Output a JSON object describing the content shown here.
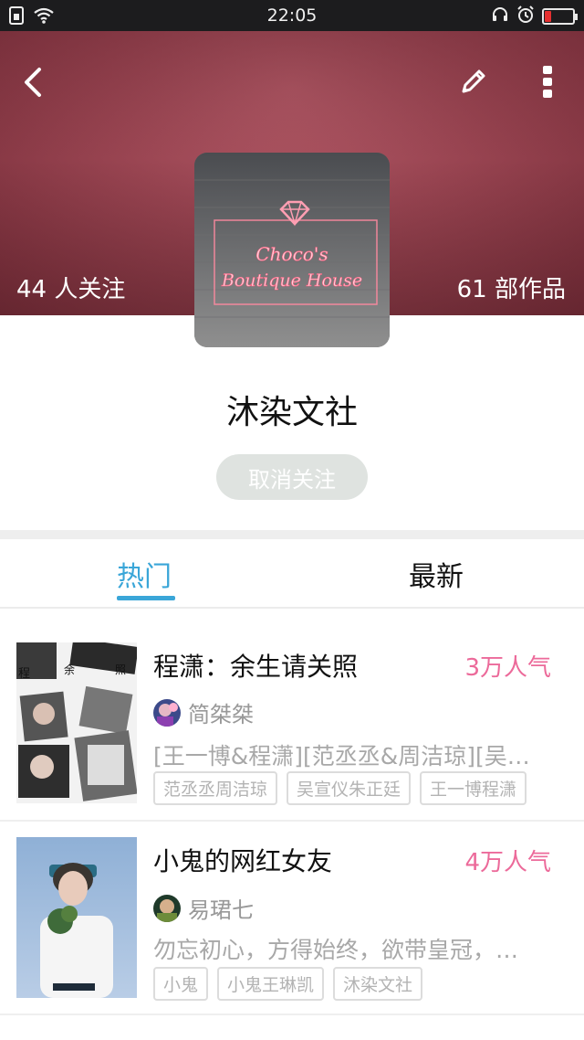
{
  "status_bar": {
    "time": "22:05"
  },
  "header": {
    "followers": "44 人关注",
    "works": "61 部作品",
    "cover_sign_line1": "Choco's",
    "cover_sign_line2": "Boutique House"
  },
  "group": {
    "name": "沐染文社",
    "unfollow_label": "取消关注"
  },
  "tabs": [
    {
      "label": "热门",
      "active": true
    },
    {
      "label": "最新",
      "active": false
    }
  ],
  "works": [
    {
      "title": "程潇：余生请关照",
      "popularity": "3万人气",
      "author": "简桀桀",
      "description": "[王一博&程潇][范丞丞&周洁琼][吴…",
      "tags": [
        "范丞丞周洁琼",
        "吴宣仪朱正廷",
        "王一博程潇"
      ]
    },
    {
      "title": "小鬼的网红女友",
      "popularity": "4万人气",
      "author": "易珺七",
      "description": "勿忘初心，方得始终，欲带皇冠，…",
      "tags": [
        "小鬼",
        "小鬼王琳凯",
        "沐染文社"
      ]
    }
  ],
  "colors": {
    "accent": "#3aa6d8",
    "popularity": "#ec6a9a",
    "header": "#9a4552"
  }
}
